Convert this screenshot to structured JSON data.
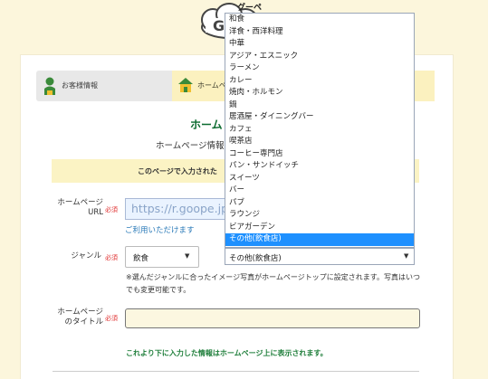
{
  "logo": {
    "text": "グーペ"
  },
  "steps": [
    {
      "label": "お客様情報"
    },
    {
      "label": "ホームペ"
    }
  ],
  "page": {
    "title": "ホーム",
    "subtitle": "ホームページ情報",
    "notice": "このページで入力された"
  },
  "form": {
    "url_label_line1": "ホームページ",
    "url_label_line2": "URL",
    "required": "必須",
    "url_placeholder": "https://r.goope.jp",
    "url_help": "ご利用いただけます",
    "genre_label": "ジャンル",
    "genre_value": "飲食",
    "genre_sub_value": "その他(飲食店)",
    "genre_note": "※選んだジャンルに合ったイメージ写真がホームページトップに設定されます。写真はいつでも変更可能です。",
    "title_label_line1": "ホームページ",
    "title_label_line2": "のタイトル",
    "bottom_text": "これより下に入力した情報はホームページ上に表示されます。"
  },
  "dropdown": {
    "options": [
      "和食",
      "洋食・西洋料理",
      "中華",
      "アジア・エスニック",
      "ラーメン",
      "カレー",
      "焼肉・ホルモン",
      "鍋",
      "居酒屋・ダイニングバー",
      "カフェ",
      "喫茶店",
      "コーヒー専門店",
      "パン・サンドイッチ",
      "スイーツ",
      "バー",
      "パブ",
      "ラウンジ",
      "ビアガーデン",
      "その他(飲食店)"
    ],
    "selected_index": 18
  },
  "colors": {
    "accent_green": "#0b6b2f",
    "highlight_blue": "#1e90ff",
    "required_red": "#e03030"
  }
}
